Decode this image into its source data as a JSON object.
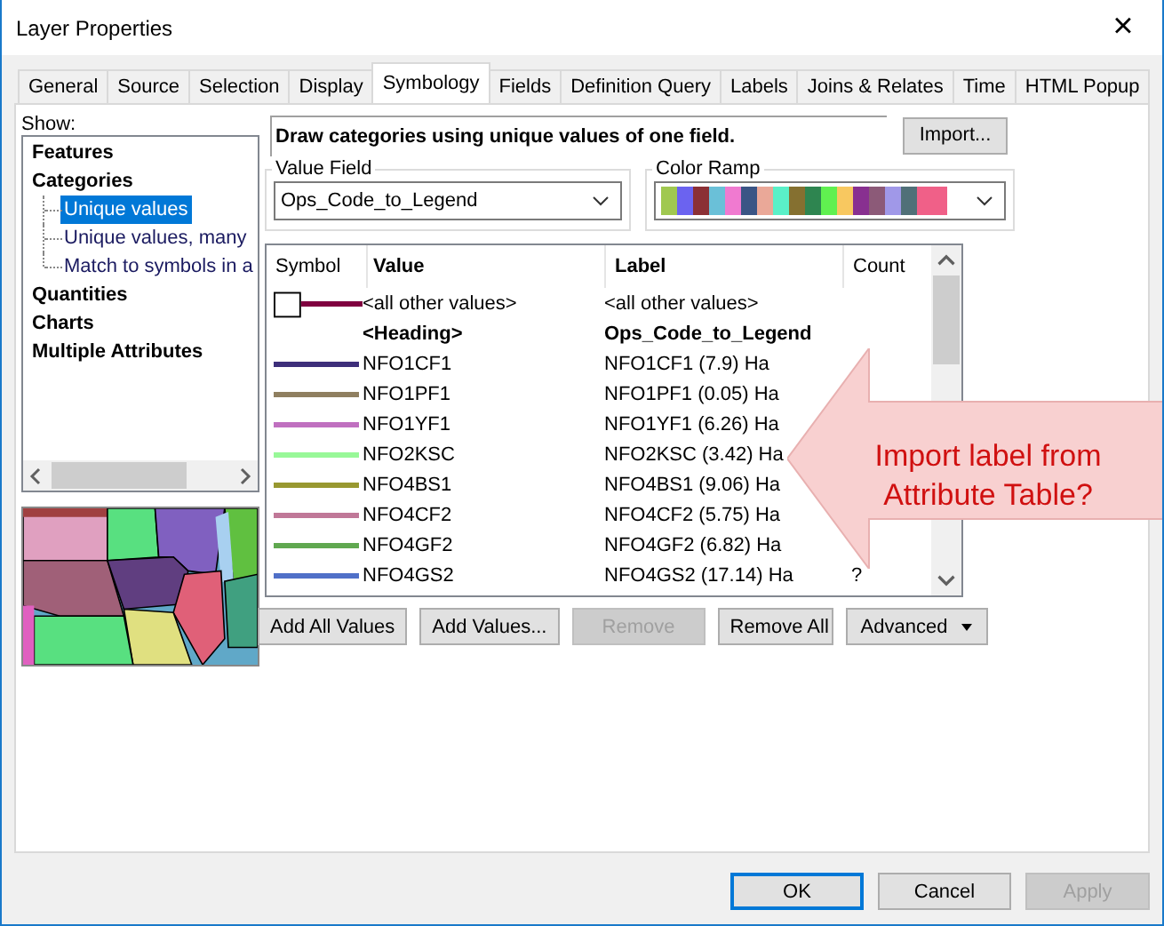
{
  "window": {
    "title": "Layer Properties",
    "close": "×"
  },
  "tabs": [
    {
      "label": "General",
      "selected": false
    },
    {
      "label": "Source",
      "selected": false
    },
    {
      "label": "Selection",
      "selected": false
    },
    {
      "label": "Display",
      "selected": false
    },
    {
      "label": "Symbology",
      "selected": true
    },
    {
      "label": "Fields",
      "selected": false
    },
    {
      "label": "Definition Query",
      "selected": false
    },
    {
      "label": "Labels",
      "selected": false
    },
    {
      "label": "Joins & Relates",
      "selected": false
    },
    {
      "label": "Time",
      "selected": false
    },
    {
      "label": "HTML Popup",
      "selected": false
    }
  ],
  "show": {
    "label": "Show:",
    "items": [
      {
        "label": "Features",
        "selected": false
      },
      {
        "label": "Categories",
        "selected": false,
        "children": [
          {
            "label": "Unique values",
            "selected": true
          },
          {
            "label": "Unique values, many",
            "selected": false
          },
          {
            "label": "Match to symbols in a",
            "selected": false
          }
        ]
      },
      {
        "label": "Quantities",
        "selected": false
      },
      {
        "label": "Charts",
        "selected": false
      },
      {
        "label": "Multiple Attributes",
        "selected": false
      }
    ]
  },
  "description": "Draw categories using unique values of one field.",
  "import_button": "Import...",
  "value_field": {
    "label": "Value Field",
    "value": "Ops_Code_to_Legend"
  },
  "color_ramp": {
    "label": "Color Ramp",
    "swatches": [
      {
        "color": "#a0c850"
      },
      {
        "color": "#6b63f0"
      },
      {
        "color": "#8b3035"
      },
      {
        "color": "#6ac0d8"
      },
      {
        "color": "#f07ad0"
      },
      {
        "color": "#3a5585"
      },
      {
        "color": "#eaa898"
      },
      {
        "color": "#5af0c8"
      },
      {
        "color": "#857030"
      },
      {
        "color": "#2e8550"
      },
      {
        "color": "#60f050"
      },
      {
        "color": "#f8c860"
      },
      {
        "color": "#883090"
      },
      {
        "color": "#8c5a78"
      },
      {
        "color": "#a098e8"
      },
      {
        "color": "#507078"
      },
      {
        "color": "#f06088"
      }
    ]
  },
  "table": {
    "columns": [
      "Symbol",
      "Value",
      "Label",
      "Count"
    ],
    "rows": [
      {
        "kind": "other",
        "color": "#800040",
        "value": "<all other values>",
        "label": "<all other values>"
      },
      {
        "kind": "heading",
        "value": "<Heading>",
        "label": "Ops_Code_to_Legend"
      },
      {
        "kind": "value",
        "color": "#3d2e7a",
        "value": "NFO1CF1",
        "label": "NFO1CF1 (7.9) Ha"
      },
      {
        "kind": "value",
        "color": "#8f7f60",
        "value": "NFO1PF1",
        "label": "NFO1PF1 (0.05) Ha"
      },
      {
        "kind": "value",
        "color": "#c070c0",
        "value": "NFO1YF1",
        "label": "NFO1YF1 (6.26) Ha"
      },
      {
        "kind": "value",
        "color": "#98f898",
        "value": "NFO2KSC",
        "label": "NFO2KSC (3.42) Ha"
      },
      {
        "kind": "value",
        "color": "#989830",
        "value": "NFO4BS1",
        "label": "NFO4BS1 (9.06) Ha"
      },
      {
        "kind": "value",
        "color": "#c07898",
        "value": "NFO4CF2",
        "label": "NFO4CF2 (5.75) Ha"
      },
      {
        "kind": "value",
        "color": "#60a850",
        "value": "NFO4GF2",
        "label": "NFO4GF2 (6.82) Ha"
      },
      {
        "kind": "value",
        "color": "#5070c8",
        "value": "NFO4GS2",
        "label": "NFO4GS2 (17.14) Ha",
        "count": "?"
      }
    ]
  },
  "actions": [
    {
      "label": "Add All Values",
      "disabled": false
    },
    {
      "label": "Add Values...",
      "disabled": false
    },
    {
      "label": "Remove",
      "disabled": true
    },
    {
      "label": "Remove All",
      "disabled": false
    }
  ],
  "advanced": "Advanced",
  "callout": "Import label from Attribute Table?",
  "buttons": [
    {
      "label": "OK",
      "default": true,
      "disabled": false
    },
    {
      "label": "Cancel",
      "default": false,
      "disabled": false
    },
    {
      "label": "Apply",
      "default": false,
      "disabled": true
    }
  ]
}
